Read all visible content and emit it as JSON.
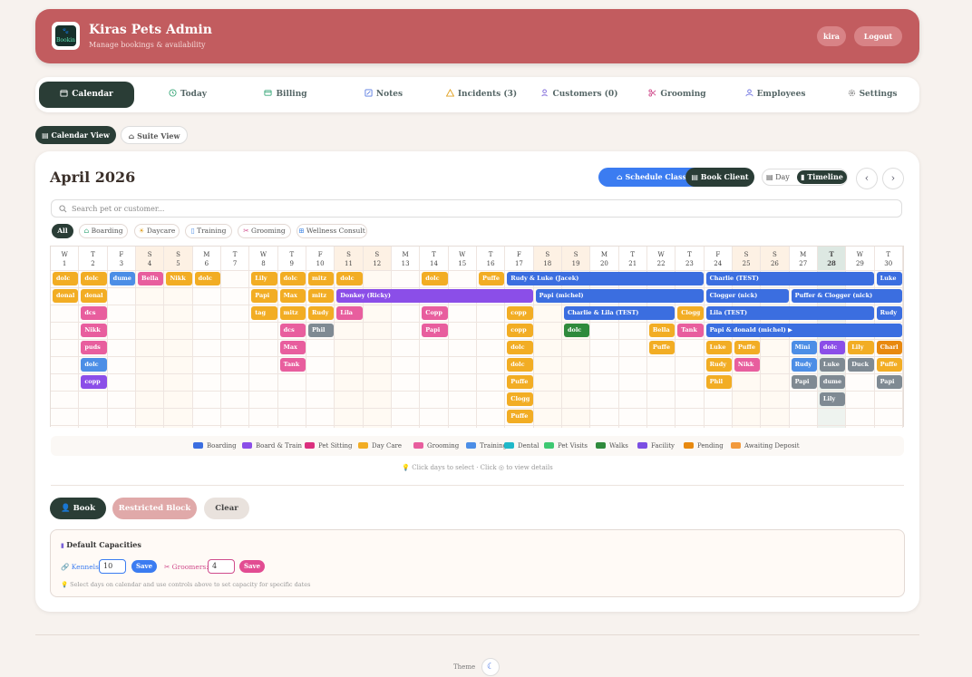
{
  "header": {
    "title": "Kiras Pets Admin",
    "subtitle": "Manage bookings & availability",
    "logo_text": "Bookin",
    "user": "kira",
    "logout": "Logout"
  },
  "nav": {
    "items": [
      {
        "label": "Calendar",
        "icon": "calendar-icon",
        "active": true
      },
      {
        "label": "Today",
        "icon": "clock-icon"
      },
      {
        "label": "Billing",
        "icon": "billing-icon"
      },
      {
        "label": "Notes",
        "icon": "notes-icon"
      },
      {
        "label": "Incidents (3)",
        "icon": "warning-icon"
      },
      {
        "label": "Customers (0)",
        "icon": "customers-icon"
      },
      {
        "label": "Grooming",
        "icon": "scissors-icon"
      },
      {
        "label": "Employees",
        "icon": "employees-icon"
      },
      {
        "label": "Settings",
        "icon": "gear-icon"
      }
    ]
  },
  "views": {
    "calendar": "Calendar View",
    "suite": "Suite View"
  },
  "calendar": {
    "month": "April 2026",
    "schedule_class": "Schedule Class",
    "book_client": "Book Client",
    "mode_day": "Day",
    "mode_timeline": "Timeline",
    "search_placeholder": "Search pet or customer...",
    "filters": [
      "All",
      "Boarding",
      "Daycare",
      "Training",
      "Grooming",
      "Wellness Consult"
    ],
    "days": [
      {
        "w": "W",
        "d": "1"
      },
      {
        "w": "T",
        "d": "2"
      },
      {
        "w": "F",
        "d": "3"
      },
      {
        "w": "S",
        "d": "4"
      },
      {
        "w": "S",
        "d": "5"
      },
      {
        "w": "M",
        "d": "6"
      },
      {
        "w": "T",
        "d": "7"
      },
      {
        "w": "W",
        "d": "8"
      },
      {
        "w": "T",
        "d": "9"
      },
      {
        "w": "F",
        "d": "10"
      },
      {
        "w": "S",
        "d": "11"
      },
      {
        "w": "S",
        "d": "12"
      },
      {
        "w": "M",
        "d": "13"
      },
      {
        "w": "T",
        "d": "14"
      },
      {
        "w": "W",
        "d": "15"
      },
      {
        "w": "T",
        "d": "16"
      },
      {
        "w": "F",
        "d": "17"
      },
      {
        "w": "S",
        "d": "18"
      },
      {
        "w": "S",
        "d": "19"
      },
      {
        "w": "M",
        "d": "20"
      },
      {
        "w": "T",
        "d": "21"
      },
      {
        "w": "W",
        "d": "22"
      },
      {
        "w": "T",
        "d": "23"
      },
      {
        "w": "F",
        "d": "24"
      },
      {
        "w": "S",
        "d": "25"
      },
      {
        "w": "S",
        "d": "26"
      },
      {
        "w": "M",
        "d": "27"
      },
      {
        "w": "T",
        "d": "28"
      },
      {
        "w": "W",
        "d": "29"
      },
      {
        "w": "T",
        "d": "30"
      }
    ],
    "today_index": 27,
    "bookings": [
      {
        "r": 0,
        "s": 0,
        "e": 0,
        "t": "dolc",
        "c": "daycare"
      },
      {
        "r": 0,
        "s": 1,
        "e": 1,
        "t": "dolc",
        "c": "daycare"
      },
      {
        "r": 0,
        "s": 2,
        "e": 2,
        "t": "dume",
        "c": "training"
      },
      {
        "r": 0,
        "s": 3,
        "e": 3,
        "t": "Bella",
        "c": "grooming"
      },
      {
        "r": 0,
        "s": 4,
        "e": 4,
        "t": "Nikk",
        "c": "daycare"
      },
      {
        "r": 0,
        "s": 5,
        "e": 5,
        "t": "dolc",
        "c": "daycare"
      },
      {
        "r": 0,
        "s": 7,
        "e": 7,
        "t": "Lily",
        "c": "daycare"
      },
      {
        "r": 0,
        "s": 8,
        "e": 8,
        "t": "dolc",
        "c": "daycare"
      },
      {
        "r": 0,
        "s": 9,
        "e": 9,
        "t": "mitz",
        "c": "daycare"
      },
      {
        "r": 0,
        "s": 10,
        "e": 10,
        "t": "dolc",
        "c": "daycare"
      },
      {
        "r": 0,
        "s": 13,
        "e": 13,
        "t": "dolc",
        "c": "daycare"
      },
      {
        "r": 0,
        "s": 15,
        "e": 15,
        "t": "Puffe",
        "c": "daycare"
      },
      {
        "r": 0,
        "s": 16,
        "e": 22,
        "t": "Rudy & Luke (Jacek)",
        "c": "boarding"
      },
      {
        "r": 0,
        "s": 23,
        "e": 28,
        "t": "Charlie (TEST)",
        "c": "boarding"
      },
      {
        "r": 0,
        "s": 29,
        "e": 29,
        "t": "Luke",
        "c": "boarding"
      },
      {
        "r": 1,
        "s": 0,
        "e": 0,
        "t": "donal",
        "c": "daycare"
      },
      {
        "r": 1,
        "s": 1,
        "e": 1,
        "t": "donal",
        "c": "daycare"
      },
      {
        "r": 1,
        "s": 7,
        "e": 7,
        "t": "Papi",
        "c": "daycare"
      },
      {
        "r": 1,
        "s": 8,
        "e": 8,
        "t": "Max",
        "c": "daycare"
      },
      {
        "r": 1,
        "s": 9,
        "e": 9,
        "t": "mitz",
        "c": "daycare"
      },
      {
        "r": 1,
        "s": 10,
        "e": 16,
        "t": "Donkey (Ricky)",
        "c": "boardtrain"
      },
      {
        "r": 1,
        "s": 17,
        "e": 22,
        "t": "Papi (michel)",
        "c": "boarding"
      },
      {
        "r": 1,
        "s": 23,
        "e": 25,
        "t": "Clogger (nick)",
        "c": "boarding"
      },
      {
        "r": 1,
        "s": 26,
        "e": 29,
        "t": "Puffer & Clogger (nick)",
        "c": "boarding"
      },
      {
        "r": 2,
        "s": 1,
        "e": 1,
        "t": "dcs",
        "c": "grooming"
      },
      {
        "r": 2,
        "s": 7,
        "e": 7,
        "t": "tag",
        "c": "daycare"
      },
      {
        "r": 2,
        "s": 8,
        "e": 8,
        "t": "mitz",
        "c": "daycare"
      },
      {
        "r": 2,
        "s": 9,
        "e": 9,
        "t": "Rudy",
        "c": "daycare"
      },
      {
        "r": 2,
        "s": 10,
        "e": 10,
        "t": "Lila",
        "c": "grooming"
      },
      {
        "r": 2,
        "s": 13,
        "e": 13,
        "t": "Copp",
        "c": "grooming"
      },
      {
        "r": 2,
        "s": 16,
        "e": 16,
        "t": "copp",
        "c": "daycare"
      },
      {
        "r": 2,
        "s": 18,
        "e": 21,
        "t": "Charlie & Lila (TEST)",
        "c": "boarding"
      },
      {
        "r": 2,
        "s": 22,
        "e": 22,
        "t": "Clogg",
        "c": "daycare"
      },
      {
        "r": 2,
        "s": 23,
        "e": 28,
        "t": "Lila (TEST)",
        "c": "boarding"
      },
      {
        "r": 2,
        "s": 29,
        "e": 29,
        "t": "Rudy",
        "c": "boarding"
      },
      {
        "r": 3,
        "s": 1,
        "e": 1,
        "t": "Nikk",
        "c": "grooming"
      },
      {
        "r": 3,
        "s": 8,
        "e": 8,
        "t": "dcs",
        "c": "grooming"
      },
      {
        "r": 3,
        "s": 9,
        "e": 9,
        "t": "Phil",
        "c": "gray"
      },
      {
        "r": 3,
        "s": 13,
        "e": 13,
        "t": "Papi",
        "c": "grooming"
      },
      {
        "r": 3,
        "s": 16,
        "e": 16,
        "t": "copp",
        "c": "daycare"
      },
      {
        "r": 3,
        "s": 18,
        "e": 18,
        "t": "dolc",
        "c": "walks"
      },
      {
        "r": 3,
        "s": 21,
        "e": 21,
        "t": "Bella",
        "c": "daycare"
      },
      {
        "r": 3,
        "s": 22,
        "e": 22,
        "t": "Tank",
        "c": "grooming"
      },
      {
        "r": 3,
        "s": 23,
        "e": 29,
        "t": "Papi & donald (michel) ▶",
        "c": "boarding"
      },
      {
        "r": 4,
        "s": 1,
        "e": 1,
        "t": "puds",
        "c": "grooming"
      },
      {
        "r": 4,
        "s": 8,
        "e": 8,
        "t": "Max",
        "c": "grooming"
      },
      {
        "r": 4,
        "s": 16,
        "e": 16,
        "t": "dolc",
        "c": "daycare"
      },
      {
        "r": 4,
        "s": 21,
        "e": 21,
        "t": "Puffe",
        "c": "daycare"
      },
      {
        "r": 4,
        "s": 23,
        "e": 23,
        "t": "Luke",
        "c": "daycare"
      },
      {
        "r": 4,
        "s": 24,
        "e": 24,
        "t": "Puffe",
        "c": "daycare"
      },
      {
        "r": 4,
        "s": 26,
        "e": 26,
        "t": "Mini",
        "c": "training"
      },
      {
        "r": 4,
        "s": 27,
        "e": 27,
        "t": "dolc",
        "c": "boardtrain"
      },
      {
        "r": 4,
        "s": 28,
        "e": 28,
        "t": "Lily",
        "c": "daycare"
      },
      {
        "r": 4,
        "s": 29,
        "e": 29,
        "t": "Charl",
        "c": "pending"
      },
      {
        "r": 5,
        "s": 1,
        "e": 1,
        "t": "dolc",
        "c": "training"
      },
      {
        "r": 5,
        "s": 8,
        "e": 8,
        "t": "Tank",
        "c": "grooming"
      },
      {
        "r": 5,
        "s": 16,
        "e": 16,
        "t": "dolc",
        "c": "daycare"
      },
      {
        "r": 5,
        "s": 23,
        "e": 23,
        "t": "Rudy",
        "c": "daycare"
      },
      {
        "r": 5,
        "s": 24,
        "e": 24,
        "t": "Nikk",
        "c": "grooming"
      },
      {
        "r": 5,
        "s": 26,
        "e": 26,
        "t": "Rudy",
        "c": "training"
      },
      {
        "r": 5,
        "s": 27,
        "e": 27,
        "t": "Luke",
        "c": "gray"
      },
      {
        "r": 5,
        "s": 28,
        "e": 28,
        "t": "Duck",
        "c": "gray"
      },
      {
        "r": 5,
        "s": 29,
        "e": 29,
        "t": "Puffe",
        "c": "daycare"
      },
      {
        "r": 6,
        "s": 1,
        "e": 1,
        "t": "copp",
        "c": "boardtrain"
      },
      {
        "r": 6,
        "s": 16,
        "e": 16,
        "t": "Puffe",
        "c": "daycare"
      },
      {
        "r": 6,
        "s": 23,
        "e": 23,
        "t": "Phil",
        "c": "daycare"
      },
      {
        "r": 6,
        "s": 26,
        "e": 26,
        "t": "Papi",
        "c": "gray"
      },
      {
        "r": 6,
        "s": 27,
        "e": 27,
        "t": "dume",
        "c": "gray"
      },
      {
        "r": 6,
        "s": 29,
        "e": 29,
        "t": "Papi",
        "c": "gray"
      },
      {
        "r": 7,
        "s": 16,
        "e": 16,
        "t": "Clogg",
        "c": "daycare"
      },
      {
        "r": 7,
        "s": 27,
        "e": 27,
        "t": "Lily",
        "c": "gray"
      },
      {
        "r": 8,
        "s": 16,
        "e": 16,
        "t": "Puffe",
        "c": "daycare"
      }
    ],
    "colors": {
      "boarding": "#3b6ee0",
      "boardtrain": "#8b4ee8",
      "petsitting": "#db2f7e",
      "daycare": "#f2ad24",
      "grooming": "#e85e9e",
      "training": "#4c8ee6",
      "dental": "#1fb8c9",
      "petvisits": "#3ec872",
      "walks": "#2f8a3c",
      "facility": "#7b4fe3",
      "pending": "#e8890f",
      "gray": "#7f8a93"
    },
    "legend": [
      {
        "label": "Boarding",
        "color": "#3b6ee0"
      },
      {
        "label": "Board & Train",
        "color": "#8b4ee8"
      },
      {
        "label": "Pet Sitting",
        "color": "#db2f7e"
      },
      {
        "label": "Day Care",
        "color": "#f2ad24"
      },
      {
        "label": "Grooming",
        "color": "#e85e9e"
      },
      {
        "label": "Training",
        "color": "#4c8ee6"
      },
      {
        "label": "Dental",
        "color": "#1fb8c9"
      },
      {
        "label": "Pet Visits",
        "color": "#3ec872"
      },
      {
        "label": "Walks",
        "color": "#2f8a3c"
      },
      {
        "label": "Facility",
        "color": "#7b4fe3"
      },
      {
        "label": "Pending",
        "color": "#e8890f"
      },
      {
        "label": "Awaiting Deposit",
        "color": "#f29a3c"
      }
    ],
    "hint": "Click days to select · Click ◎ to view details"
  },
  "actions": {
    "book": "Book",
    "restricted": "Restricted Block",
    "clear": "Clear"
  },
  "capacities": {
    "title": "Default Capacities",
    "kennels_label": "Kennels:",
    "kennels": "10",
    "groomers_label": "Groomers:",
    "groomers": "4",
    "save": "Save",
    "hint": "Select days on calendar and use controls above to set capacity for specific dates"
  },
  "footer": {
    "theme": "Theme"
  }
}
